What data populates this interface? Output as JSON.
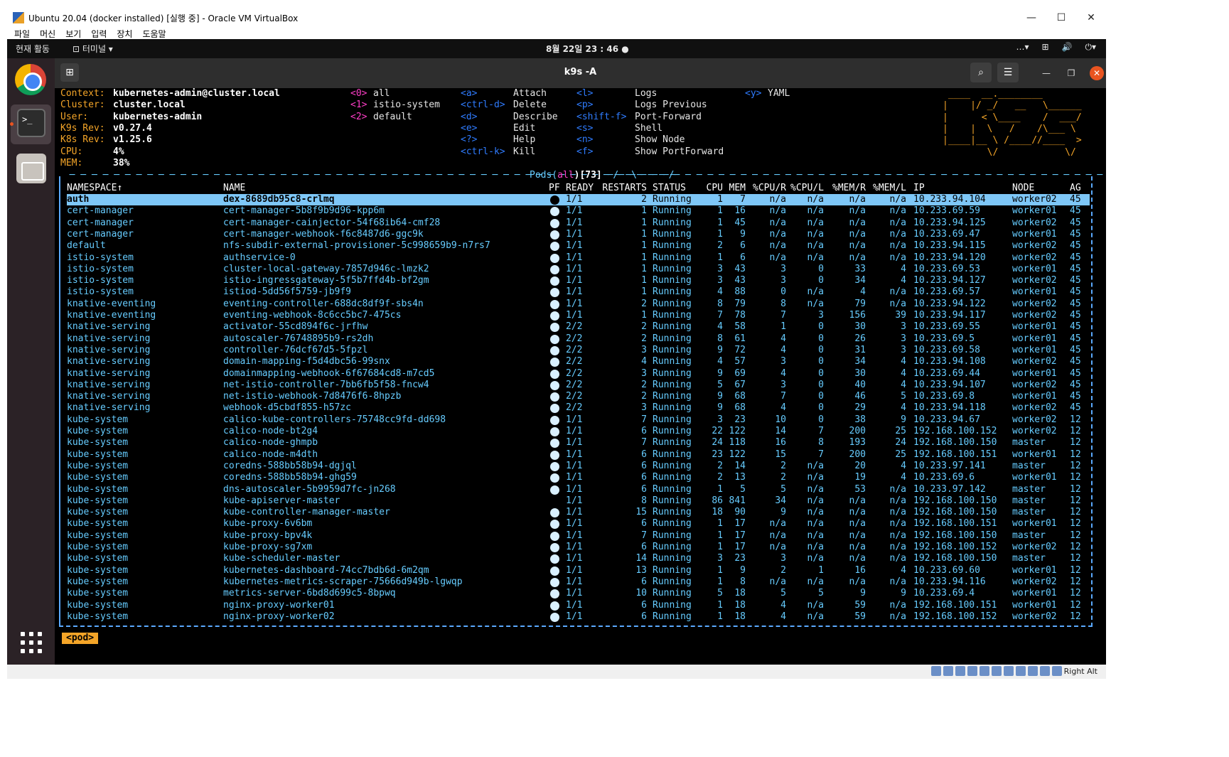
{
  "window": {
    "title": "Ubuntu 20.04 (docker installed) [실행 중] - Oracle VM VirtualBox",
    "controls": [
      "—",
      "☐",
      "✕"
    ]
  },
  "menu": [
    "파일",
    "머신",
    "보기",
    "입력",
    "장치",
    "도움말"
  ],
  "topbar": {
    "activities": "현재 활동",
    "app_menu": "터미널 ▾",
    "clock": "8월 22일  23 : 46",
    "indicator": "●",
    "tray": [
      "…▾",
      "⊞",
      "🔊",
      "⏻▾"
    ]
  },
  "terminal": {
    "title": "k9s -A"
  },
  "k9s": {
    "info": [
      {
        "label": "Context:",
        "value": "kubernetes-admin@cluster.local"
      },
      {
        "label": "Cluster:",
        "value": "cluster.local"
      },
      {
        "label": "User:",
        "value": "kubernetes-admin"
      },
      {
        "label": "K9s Rev:",
        "value": "v0.27.4"
      },
      {
        "label": "K8s Rev:",
        "value": "v1.25.6"
      },
      {
        "label": "CPU:",
        "value": "4%"
      },
      {
        "label": "MEM:",
        "value": "38%"
      }
    ],
    "namespaces": [
      {
        "key": "<0>",
        "label": "all"
      },
      {
        "key": "<1>",
        "label": "istio-system"
      },
      {
        "key": "<2>",
        "label": "default"
      }
    ],
    "hotkeys_a": [
      {
        "key": "<a>",
        "label": "Attach"
      },
      {
        "key": "<ctrl-d>",
        "label": "Delete"
      },
      {
        "key": "<d>",
        "label": "Describe"
      },
      {
        "key": "<e>",
        "label": "Edit"
      },
      {
        "key": "<?>",
        "label": "Help"
      },
      {
        "key": "<ctrl-k>",
        "label": "Kill"
      }
    ],
    "hotkeys_b": [
      {
        "key": "<l>",
        "label": "Logs"
      },
      {
        "key": "<p>",
        "label": "Logs Previous"
      },
      {
        "key": "<shift-f>",
        "label": "Port-Forward"
      },
      {
        "key": "<s>",
        "label": "Shell"
      },
      {
        "key": "<n>",
        "label": "Show Node"
      },
      {
        "key": "<f>",
        "label": "Show PortForward"
      }
    ],
    "hotkeys_c": [
      {
        "key": "<y>",
        "label": "YAML"
      }
    ],
    "logo": [
      " ____  __.________       ",
      "|    |/ _/   __   \\______",
      "|      < \\____    /  ___/",
      "|    |  \\   /    /\\___ \\ ",
      "|____|__ \\ /____//____  >",
      "        \\/            \\/ "
    ],
    "pods_title": {
      "prefix": "Pods(",
      "scope": "all",
      "suffix": ")[73]"
    },
    "frame_left": "  ─ ─ ─ ─ ─ ─ ─ ─ ─ ─ ─ ─ ─ ─ ─ ─ ─ ─ ─ ─ ─ ─ ─ ─ ─ ─ ─ ─ ─ ─ ─ ─ ─ ─ ─ ─ ─ ─ ─ ─ ─ ─ ─ ─ ─ ─ ─ ─ ─ ─ ─\\─ ─ ─ ─ ",
    "frame_right": " ─/─ ─ ─ ─ ─/─ ─ ─ ─ ─ ─ ─ ─ ─ ─ ─ ─ ─ ─ ─ ─ ─ ─ ─ ─ ─ ─ ─ ─ ─ ─ ─ ─ ─ ─ ─ ─ ─ ─ ─ ─ ─ ─ ─ ─",
    "columns": [
      "NAMESPACE↑",
      "NAME",
      "PF",
      "READY",
      "RESTARTS",
      "STATUS",
      "CPU",
      "MEM",
      "%CPU/R",
      "%CPU/L",
      "%MEM/R",
      "%MEM/L",
      "IP",
      "NODE",
      "AG"
    ],
    "rows": [
      [
        "auth",
        "dex-8689db95c8-crlmq",
        "1/1",
        "2",
        "Running",
        "1",
        "7",
        "n/a",
        "n/a",
        "n/a",
        "n/a",
        "10.233.94.104",
        "worker02",
        "45"
      ],
      [
        "cert-manager",
        "cert-manager-5b8f9b9d96-kpp6m",
        "1/1",
        "1",
        "Running",
        "1",
        "16",
        "n/a",
        "n/a",
        "n/a",
        "n/a",
        "10.233.69.59",
        "worker01",
        "45"
      ],
      [
        "cert-manager",
        "cert-manager-cainjector-54f68ib64-cmf28",
        "1/1",
        "1",
        "Running",
        "1",
        "45",
        "n/a",
        "n/a",
        "n/a",
        "n/a",
        "10.233.94.125",
        "worker02",
        "45"
      ],
      [
        "cert-manager",
        "cert-manager-webhook-f6c8487d6-ggc9k",
        "1/1",
        "1",
        "Running",
        "1",
        "9",
        "n/a",
        "n/a",
        "n/a",
        "n/a",
        "10.233.69.47",
        "worker01",
        "45"
      ],
      [
        "default",
        "nfs-subdir-external-provisioner-5c998659b9-n7rs7",
        "1/1",
        "1",
        "Running",
        "2",
        "6",
        "n/a",
        "n/a",
        "n/a",
        "n/a",
        "10.233.94.115",
        "worker02",
        "45"
      ],
      [
        "istio-system",
        "authservice-0",
        "1/1",
        "1",
        "Running",
        "1",
        "6",
        "n/a",
        "n/a",
        "n/a",
        "n/a",
        "10.233.94.120",
        "worker02",
        "45"
      ],
      [
        "istio-system",
        "cluster-local-gateway-7857d946c-lmzk2",
        "1/1",
        "1",
        "Running",
        "3",
        "43",
        "3",
        "0",
        "33",
        "4",
        "10.233.69.53",
        "worker01",
        "45"
      ],
      [
        "istio-system",
        "istio-ingressgateway-5f5b7ffd4b-bf2gm",
        "1/1",
        "1",
        "Running",
        "3",
        "43",
        "3",
        "0",
        "34",
        "4",
        "10.233.94.127",
        "worker02",
        "45"
      ],
      [
        "istio-system",
        "istiod-5dd56f5759-jb9f9",
        "1/1",
        "1",
        "Running",
        "4",
        "88",
        "0",
        "n/a",
        "4",
        "n/a",
        "10.233.69.57",
        "worker01",
        "45"
      ],
      [
        "knative-eventing",
        "eventing-controller-688dc8df9f-sbs4n",
        "1/1",
        "2",
        "Running",
        "8",
        "79",
        "8",
        "n/a",
        "79",
        "n/a",
        "10.233.94.122",
        "worker02",
        "45"
      ],
      [
        "knative-eventing",
        "eventing-webhook-8c6cc5bc7-475cs",
        "1/1",
        "1",
        "Running",
        "7",
        "78",
        "7",
        "3",
        "156",
        "39",
        "10.233.94.117",
        "worker02",
        "45"
      ],
      [
        "knative-serving",
        "activator-55cd894f6c-jrfhw",
        "2/2",
        "2",
        "Running",
        "4",
        "58",
        "1",
        "0",
        "30",
        "3",
        "10.233.69.55",
        "worker01",
        "45"
      ],
      [
        "knative-serving",
        "autoscaler-76748895b9-rs2dh",
        "2/2",
        "2",
        "Running",
        "8",
        "61",
        "4",
        "0",
        "26",
        "3",
        "10.233.69.5",
        "worker01",
        "45"
      ],
      [
        "knative-serving",
        "controller-76dcf67d5-5fpzl",
        "2/2",
        "3",
        "Running",
        "9",
        "72",
        "4",
        "0",
        "31",
        "3",
        "10.233.69.58",
        "worker01",
        "45"
      ],
      [
        "knative-serving",
        "domain-mapping-f5d4dbc56-99snx",
        "2/2",
        "4",
        "Running",
        "4",
        "57",
        "3",
        "0",
        "34",
        "4",
        "10.233.94.108",
        "worker02",
        "45"
      ],
      [
        "knative-serving",
        "domainmapping-webhook-6f67684cd8-m7cd5",
        "2/2",
        "3",
        "Running",
        "9",
        "69",
        "4",
        "0",
        "30",
        "4",
        "10.233.69.44",
        "worker01",
        "45"
      ],
      [
        "knative-serving",
        "net-istio-controller-7bb6fb5f58-fncw4",
        "2/2",
        "2",
        "Running",
        "5",
        "67",
        "3",
        "0",
        "40",
        "4",
        "10.233.94.107",
        "worker02",
        "45"
      ],
      [
        "knative-serving",
        "net-istio-webhook-7d8476f6-8hpzb",
        "2/2",
        "2",
        "Running",
        "9",
        "68",
        "7",
        "0",
        "46",
        "5",
        "10.233.69.8",
        "worker01",
        "45"
      ],
      [
        "knative-serving",
        "webhook-d5cbdf855-h57zc",
        "2/2",
        "3",
        "Running",
        "9",
        "68",
        "4",
        "0",
        "29",
        "4",
        "10.233.94.118",
        "worker02",
        "45"
      ],
      [
        "kube-system",
        "calico-kube-controllers-75748cc9fd-dd698",
        "1/1",
        "7",
        "Running",
        "3",
        "23",
        "10",
        "0",
        "38",
        "9",
        "10.233.94.67",
        "worker02",
        "12"
      ],
      [
        "kube-system",
        "calico-node-bt2g4",
        "1/1",
        "6",
        "Running",
        "22",
        "122",
        "14",
        "7",
        "200",
        "25",
        "192.168.100.152",
        "worker02",
        "12"
      ],
      [
        "kube-system",
        "calico-node-ghmpb",
        "1/1",
        "7",
        "Running",
        "24",
        "118",
        "16",
        "8",
        "193",
        "24",
        "192.168.100.150",
        "master",
        "12"
      ],
      [
        "kube-system",
        "calico-node-m4dth",
        "1/1",
        "6",
        "Running",
        "23",
        "122",
        "15",
        "7",
        "200",
        "25",
        "192.168.100.151",
        "worker01",
        "12"
      ],
      [
        "kube-system",
        "coredns-588bb58b94-dgjql",
        "1/1",
        "6",
        "Running",
        "2",
        "14",
        "2",
        "n/a",
        "20",
        "4",
        "10.233.97.141",
        "master",
        "12"
      ],
      [
        "kube-system",
        "coredns-588bb58b94-ghg59",
        "1/1",
        "6",
        "Running",
        "2",
        "13",
        "2",
        "n/a",
        "19",
        "4",
        "10.233.69.6",
        "worker01",
        "12"
      ],
      [
        "kube-system",
        "dns-autoscaler-5b9959d7fc-jn268",
        "1/1",
        "6",
        "Running",
        "1",
        "5",
        "5",
        "n/a",
        "53",
        "n/a",
        "10.233.97.142",
        "master",
        "12"
      ],
      [
        "kube-system",
        "kube-apiserver-master",
        "1/1",
        "8",
        "Running",
        "86",
        "841",
        "34",
        "n/a",
        "n/a",
        "n/a",
        "192.168.100.150",
        "master",
        "12"
      ],
      [
        "kube-system",
        "kube-controller-manager-master",
        "1/1",
        "15",
        "Running",
        "18",
        "90",
        "9",
        "n/a",
        "n/a",
        "n/a",
        "192.168.100.150",
        "master",
        "12"
      ],
      [
        "kube-system",
        "kube-proxy-6v6bm",
        "1/1",
        "6",
        "Running",
        "1",
        "17",
        "n/a",
        "n/a",
        "n/a",
        "n/a",
        "192.168.100.151",
        "worker01",
        "12"
      ],
      [
        "kube-system",
        "kube-proxy-bpv4k",
        "1/1",
        "7",
        "Running",
        "1",
        "17",
        "n/a",
        "n/a",
        "n/a",
        "n/a",
        "192.168.100.150",
        "master",
        "12"
      ],
      [
        "kube-system",
        "kube-proxy-sg7xm",
        "1/1",
        "6",
        "Running",
        "1",
        "17",
        "n/a",
        "n/a",
        "n/a",
        "n/a",
        "192.168.100.152",
        "worker02",
        "12"
      ],
      [
        "kube-system",
        "kube-scheduler-master",
        "1/1",
        "14",
        "Running",
        "3",
        "23",
        "3",
        "n/a",
        "n/a",
        "n/a",
        "192.168.100.150",
        "master",
        "12"
      ],
      [
        "kube-system",
        "kubernetes-dashboard-74cc7bdb6d-6m2qm",
        "1/1",
        "13",
        "Running",
        "1",
        "9",
        "2",
        "1",
        "16",
        "4",
        "10.233.69.60",
        "worker01",
        "12"
      ],
      [
        "kube-system",
        "kubernetes-metrics-scraper-75666d949b-lgwqp",
        "1/1",
        "6",
        "Running",
        "1",
        "8",
        "n/a",
        "n/a",
        "n/a",
        "n/a",
        "10.233.94.116",
        "worker02",
        "12"
      ],
      [
        "kube-system",
        "metrics-server-6bd8d699c5-8bpwq",
        "1/1",
        "10",
        "Running",
        "5",
        "18",
        "5",
        "5",
        "9",
        "9",
        "10.233.69.4",
        "worker01",
        "12"
      ],
      [
        "kube-system",
        "nginx-proxy-worker01",
        "1/1",
        "6",
        "Running",
        "1",
        "18",
        "4",
        "n/a",
        "59",
        "n/a",
        "192.168.100.151",
        "worker01",
        "12"
      ],
      [
        "kube-system",
        "nginx-proxy-worker02",
        "1/1",
        "6",
        "Running",
        "1",
        "18",
        "4",
        "n/a",
        "59",
        "n/a",
        "192.168.100.152",
        "worker02",
        "12"
      ]
    ],
    "command": "<pod>"
  },
  "statusbar": {
    "host_key": "Right Alt"
  }
}
